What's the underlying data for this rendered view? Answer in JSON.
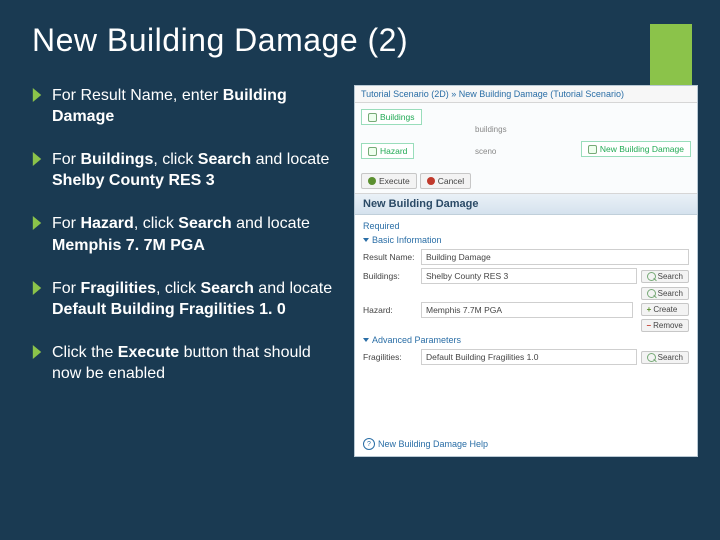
{
  "title": "New Building Damage (2)",
  "bullets": [
    {
      "pre": "For Result Name, enter ",
      "bold": "Building Damage",
      "post": ""
    },
    {
      "pre": "For ",
      "bold": "Buildings",
      "post": ", click ",
      "bold2": "Search",
      "post2": " and locate ",
      "bold3": "Shelby County RES 3"
    },
    {
      "pre": "For ",
      "bold": "Hazard",
      "post": ", click ",
      "bold2": "Search",
      "post2": " and locate ",
      "bold3": "Memphis 7. 7M PGA"
    },
    {
      "pre": "For ",
      "bold": "Fragilities",
      "post": ", click ",
      "bold2": "Search",
      "post2": " and locate ",
      "bold3": "Default Building Fragilities 1. 0"
    },
    {
      "pre": "Click the ",
      "bold": "Execute",
      "post": " button that should now be enabled"
    }
  ],
  "screenshot": {
    "crumbs": "Tutorial Scenario (2D)  »  New Building Damage (Tutorial Scenario)",
    "nodes": {
      "buildings": "Buildings",
      "hazard": "Hazard",
      "analysis": "New Building Damage",
      "out1": "buildings",
      "out2": "sceno"
    },
    "toolbar": {
      "execute": "Execute",
      "cancel": "Cancel"
    },
    "panel_title": "New Building Damage",
    "required_label": "Required",
    "basic_info": "Basic Information",
    "rows": {
      "result_name": {
        "label": "Result Name:",
        "value": "Building Damage"
      },
      "buildings": {
        "label": "Buildings:",
        "value": "Shelby County RES 3"
      },
      "hazard": {
        "label": "Hazard:",
        "value": "Memphis 7.7M PGA"
      }
    },
    "buttons": {
      "search": "Search",
      "create": "Create",
      "remove": "Remove"
    },
    "advanced": "Advanced Parameters",
    "fragilities": {
      "label": "Fragilities:",
      "value": "Default Building Fragilities 1.0"
    },
    "help": "New Building Damage Help"
  }
}
